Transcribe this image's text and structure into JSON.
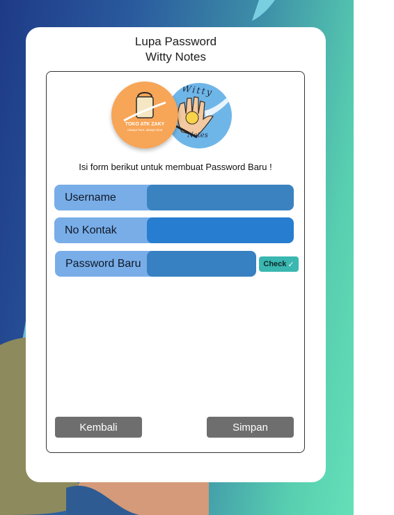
{
  "header": {
    "title_line1": "Lupa Password",
    "title_line2": "Witty Notes"
  },
  "logos": {
    "toko": {
      "name": "TOKO ATK ZAKY",
      "tagline": "Always here, always best",
      "icon": "shopping-bag-icon",
      "color": "#f7a557"
    },
    "witty": {
      "text_top": "Witty",
      "text_bottom": "Notes",
      "icon": "hand-lightbulb-icon",
      "color": "#6fb6e8"
    }
  },
  "form": {
    "instruction": "Isi form berikut untuk membuat Password Baru !",
    "fields": [
      {
        "label": "Username",
        "value": ""
      },
      {
        "label": "No Kontak",
        "value": ""
      },
      {
        "label": "Password Baru",
        "value": ""
      }
    ],
    "check_label": "Check",
    "check_icon": "checkmark-icon"
  },
  "actions": {
    "back_label": "Kembali",
    "save_label": "Simpan"
  },
  "colors": {
    "field_label_bg": "#78ade8",
    "field_input_bg": "#3b82c0",
    "check_button": "#3ab7b0",
    "action_button": "#6e6e6e"
  }
}
